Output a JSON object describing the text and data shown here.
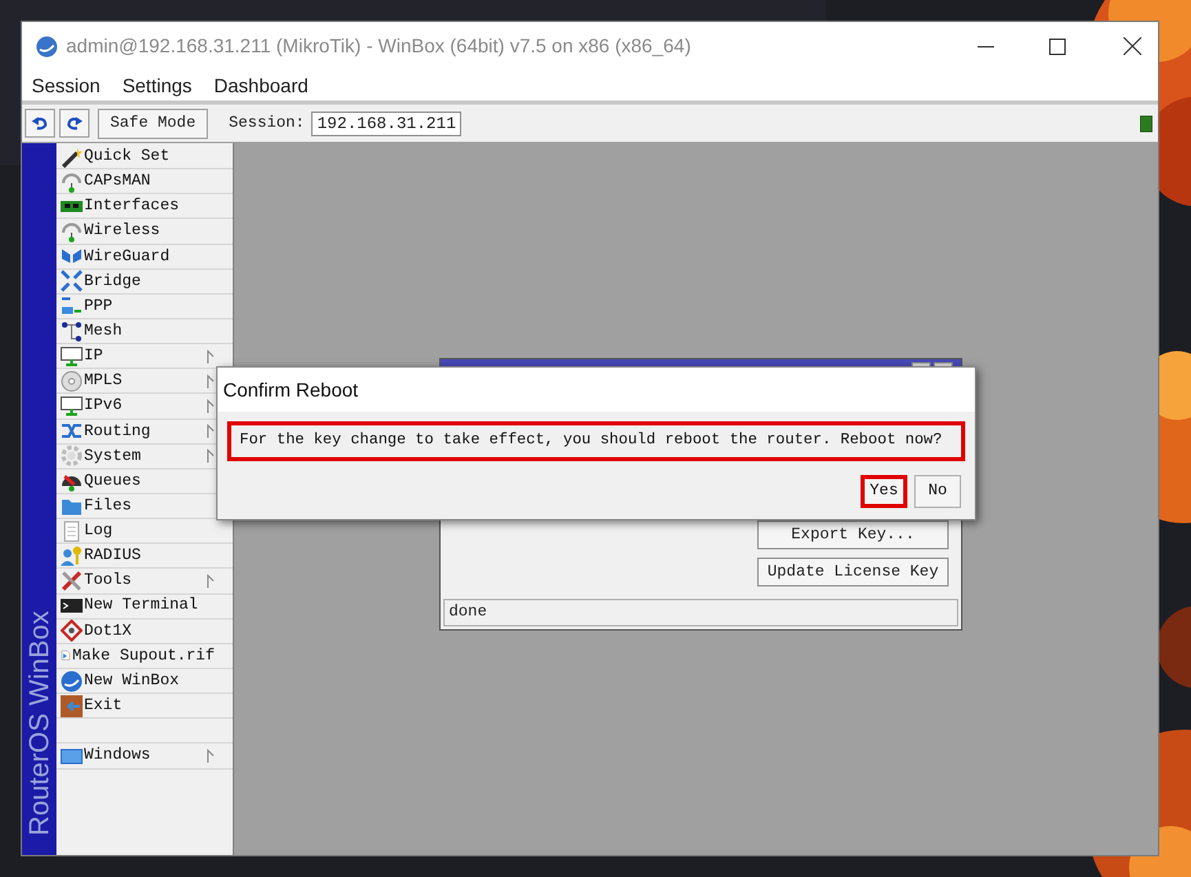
{
  "window": {
    "title": "admin@192.168.31.211 (MikroTik) - WinBox (64bit) v7.5 on x86 (x86_64)"
  },
  "menu": [
    "Session",
    "Settings",
    "Dashboard"
  ],
  "toolbar": {
    "safe_mode": "Safe Mode",
    "session_label": "Session:",
    "session_value": "192.168.31.211"
  },
  "sidebar": {
    "brand": "RouterOS WinBox",
    "items": [
      {
        "kind": "item",
        "label": "Quick Set",
        "submenu": false
      },
      {
        "kind": "item",
        "label": "CAPsMAN",
        "submenu": false
      },
      {
        "kind": "item",
        "label": "Interfaces",
        "submenu": false
      },
      {
        "kind": "item",
        "label": "Wireless",
        "submenu": false
      },
      {
        "kind": "item",
        "label": "WireGuard",
        "submenu": false
      },
      {
        "kind": "item",
        "label": "Bridge",
        "submenu": false
      },
      {
        "kind": "item",
        "label": "PPP",
        "submenu": false
      },
      {
        "kind": "item",
        "label": "Mesh",
        "submenu": false
      },
      {
        "kind": "item",
        "label": "IP",
        "submenu": true
      },
      {
        "kind": "item",
        "label": "MPLS",
        "submenu": true
      },
      {
        "kind": "item",
        "label": "IPv6",
        "submenu": true
      },
      {
        "kind": "item",
        "label": "Routing",
        "submenu": true
      },
      {
        "kind": "item",
        "label": "System",
        "submenu": true
      },
      {
        "kind": "item",
        "label": "Queues",
        "submenu": false
      },
      {
        "kind": "item",
        "label": "Files",
        "submenu": false
      },
      {
        "kind": "item",
        "label": "Log",
        "submenu": false
      },
      {
        "kind": "item",
        "label": "RADIUS",
        "submenu": false
      },
      {
        "kind": "item",
        "label": "Tools",
        "submenu": true
      },
      {
        "kind": "item",
        "label": "New Terminal",
        "submenu": false
      },
      {
        "kind": "item",
        "label": "Dot1X",
        "submenu": false
      },
      {
        "kind": "item",
        "label": "Make Supout.rif",
        "submenu": false
      },
      {
        "kind": "item",
        "label": "New WinBox",
        "submenu": false
      },
      {
        "kind": "item",
        "label": "Exit",
        "submenu": false
      },
      {
        "kind": "separator"
      },
      {
        "kind": "item",
        "label": "Windows",
        "submenu": true
      }
    ]
  },
  "inner_window": {
    "buttons": [
      "Export Key...",
      "Update License Key"
    ],
    "status": "done"
  },
  "dialog": {
    "title": "Confirm Reboot",
    "message": {
      "text": "For the key change to take effect, you should reboot the router. Reboot now?",
      "highlighted": true
    },
    "buttons": [
      {
        "label": "Yes",
        "highlighted": true
      },
      {
        "label": "No",
        "highlighted": false
      }
    ]
  }
}
